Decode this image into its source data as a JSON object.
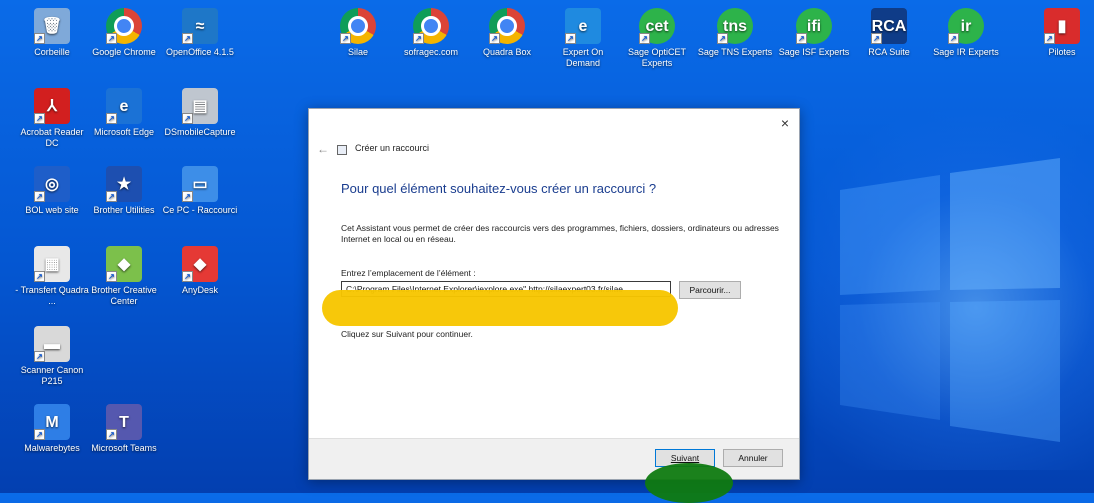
{
  "desktop": {
    "icons": [
      {
        "label": "Corbeille",
        "glyph": "🗑",
        "bg": "#7fa9d9"
      },
      {
        "label": "Google Chrome",
        "glyph": "",
        "bg": "chrome"
      },
      {
        "label": "OpenOffice 4.1.5",
        "glyph": "≈",
        "bg": "#1e77c8"
      },
      {
        "label": "Silae",
        "glyph": "",
        "bg": "chrome"
      },
      {
        "label": "sofragec.com",
        "glyph": "",
        "bg": "chrome"
      },
      {
        "label": "Quadra Box",
        "glyph": "",
        "bg": "chrome"
      },
      {
        "label": "Expert On Demand",
        "glyph": "e",
        "bg": "#1f8ae0"
      },
      {
        "label": "Sage OptiCET Experts",
        "glyph": "cet",
        "bg": "#2db34a"
      },
      {
        "label": "Sage TNS Experts",
        "glyph": "tns",
        "bg": "#2db34a"
      },
      {
        "label": "Sage ISF Experts",
        "glyph": "ifi",
        "bg": "#2db34a"
      },
      {
        "label": "RCA Suite",
        "glyph": "RCA",
        "bg": "#0f3c88"
      },
      {
        "label": "Sage IR Experts",
        "glyph": "ir",
        "bg": "#2db34a"
      },
      {
        "label": "Pilotes",
        "glyph": "▮",
        "bg": "#d92c2c"
      },
      {
        "label": "Acrobat Reader DC",
        "glyph": "⅄",
        "bg": "#d21f1f"
      },
      {
        "label": "Microsoft Edge",
        "glyph": "e",
        "bg": "#1b72d6"
      },
      {
        "label": "DSmobileCapture",
        "glyph": "▤",
        "bg": "#bfc6cf"
      },
      {
        "label": "BOL web site",
        "glyph": "◎",
        "bg": "#1e5ec9"
      },
      {
        "label": "Brother Utilities",
        "glyph": "★",
        "bg": "#1d4fb0"
      },
      {
        "label": "Ce PC - Raccourci",
        "glyph": "▭",
        "bg": "#3d8ee8"
      },
      {
        "label": "- Transfert Quadra ...",
        "glyph": "▦",
        "bg": "#e8e8e8"
      },
      {
        "label": "Brother Creative Center",
        "glyph": "◆",
        "bg": "#7cc04b"
      },
      {
        "label": "AnyDesk",
        "glyph": "◆",
        "bg": "#e53935"
      },
      {
        "label": "Scanner Canon P215",
        "glyph": "▬",
        "bg": "#d9d9d9"
      },
      {
        "label": "Malwarebytes",
        "glyph": "M",
        "bg": "#2e7ee6"
      },
      {
        "label": "Microsoft Teams",
        "glyph": "T",
        "bg": "#5558af"
      }
    ]
  },
  "dialog": {
    "close": "×",
    "back": "←",
    "title": "Créer un raccourci",
    "heading": "Pour quel élément souhaitez-vous créer un raccourci ?",
    "description": "Cet Assistant vous permet de créer des raccourcis vers des programmes, fichiers, dossiers, ordinateurs ou adresses Internet en local ou en réseau.",
    "location_label": "Entrez l’emplacement de l’élément :",
    "location_value": "C:\\Program Files\\Internet Explorer\\iexplore.exe\" http://silaexpert03.fr/silae",
    "browse_label": "Parcourir...",
    "hint": "Cliquez sur Suivant pour continuer.",
    "next_label": "Suivant",
    "cancel_label": "Annuler"
  }
}
